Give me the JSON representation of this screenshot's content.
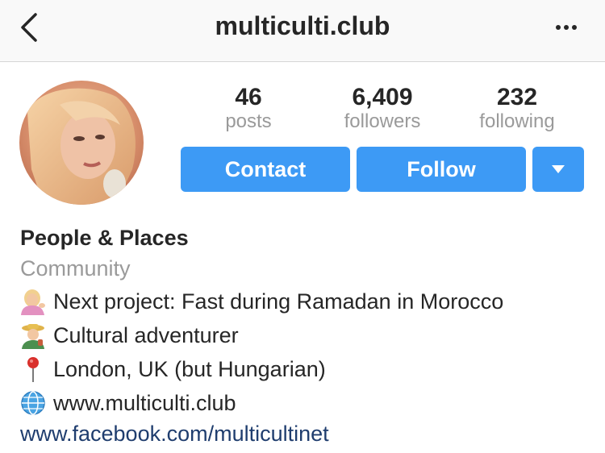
{
  "header": {
    "title": "multiculti.club",
    "back_icon": "chevron-left-icon",
    "more_icon": "more-horizontal-icon"
  },
  "profile": {
    "stats": [
      {
        "value": "46",
        "label": "posts"
      },
      {
        "value": "6,409",
        "label": "followers"
      },
      {
        "value": "232",
        "label": "following"
      }
    ],
    "buttons": {
      "contact": "Contact",
      "follow": "Follow",
      "dropdown_icon": "caret-down-icon"
    },
    "name": "People & Places",
    "category": "Community",
    "bio": [
      {
        "icon": "person-tipping-hand-emoji",
        "text": "Next project: Fast during Ramadan in Morocco"
      },
      {
        "icon": "farmer-emoji",
        "text": "Cultural adventurer"
      },
      {
        "icon": "round-pushpin-emoji",
        "text": "London, UK (but Hungarian)"
      },
      {
        "icon": "globe-with-meridians-emoji",
        "text": "www.multiculti.club"
      }
    ],
    "link": "www.facebook.com/multicultinet"
  },
  "colors": {
    "accent": "#3d9af5",
    "link": "#1f3d6e",
    "secondary_text": "#9a9a9a",
    "primary_text": "#262626"
  }
}
